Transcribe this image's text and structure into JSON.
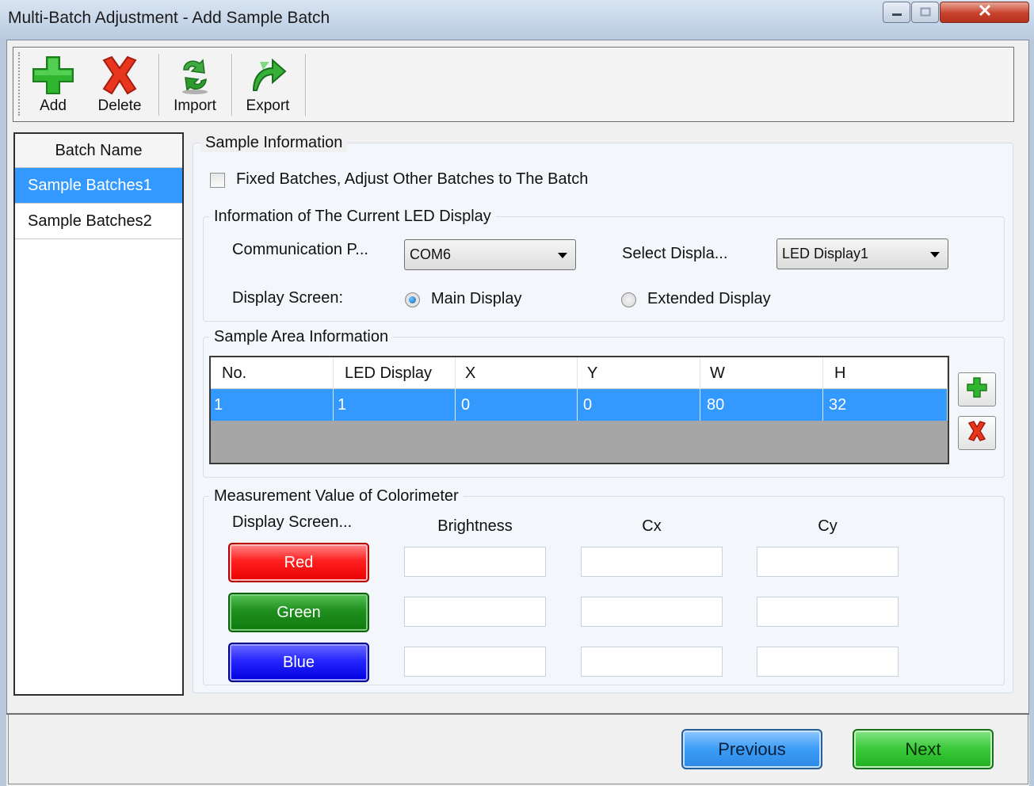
{
  "window": {
    "title": "Multi-Batch Adjustment - Add Sample Batch",
    "minimize_icon": "minimize-icon",
    "maximize_icon": "maximize-icon",
    "close_icon": "close-icon"
  },
  "toolbar": {
    "add_label": "Add",
    "delete_label": "Delete",
    "import_label": "Import",
    "export_label": "Export"
  },
  "batches": {
    "header": "Batch Name",
    "items": [
      "Sample Batches1",
      "Sample Batches2"
    ],
    "selected": "Sample Batches1"
  },
  "sample_info": {
    "title": "Sample Information",
    "fixed_checkbox_label": "Fixed Batches, Adjust Other Batches to The Batch",
    "fixed_checked": false
  },
  "led_display": {
    "title": "Information of The Current LED Display",
    "comm_port_label": "Communication P...",
    "comm_port_value": "COM6",
    "select_display_label": "Select Displa...",
    "select_display_value": "LED Display1",
    "display_screen_label": "Display Screen:",
    "main_display_label": "Main Display",
    "extended_display_label": "Extended Display",
    "selected_screen": "Main Display"
  },
  "sample_area": {
    "title": "Sample Area Information",
    "columns": [
      "No.",
      "LED Display",
      "X",
      "Y",
      "W",
      "H"
    ],
    "rows": [
      [
        "1",
        "1",
        "0",
        "0",
        "80",
        "32"
      ]
    ]
  },
  "colorimeter": {
    "title": "Measurement Value of Colorimeter",
    "display_screen_header": "Display Screen...",
    "brightness_header": "Brightness",
    "cx_header": "Cx",
    "cy_header": "Cy",
    "red_label": "Red",
    "green_label": "Green",
    "blue_label": "Blue",
    "colors": {
      "red": "#ff2020",
      "green": "#1f8f1f",
      "blue": "#2626ff"
    }
  },
  "footer": {
    "previous_label": "Previous",
    "next_label": "Next"
  }
}
